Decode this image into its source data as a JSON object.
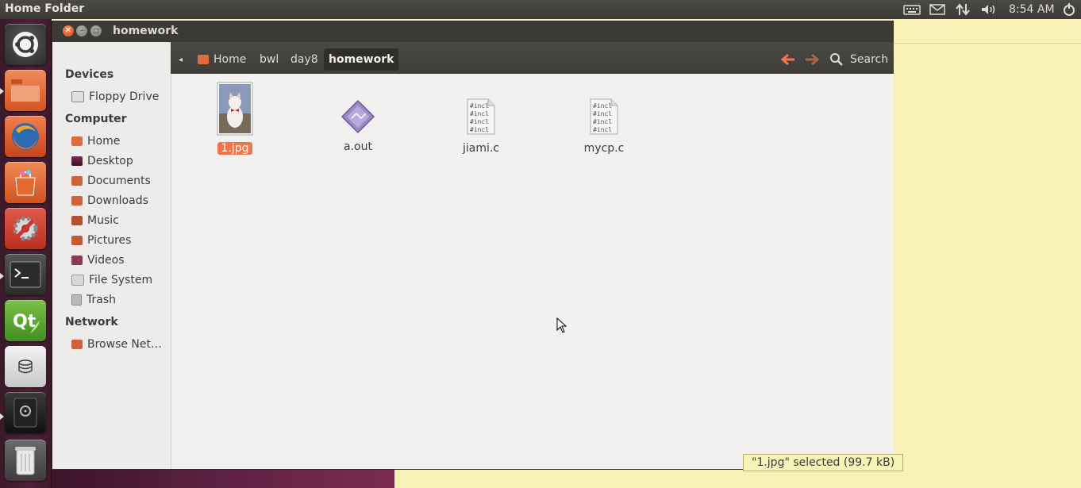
{
  "top_panel": {
    "title": "Home Folder",
    "clock": "8:54 AM",
    "tray_icons": [
      "keyboard-icon",
      "mail-icon",
      "network-icon",
      "volume-icon",
      "power-icon"
    ]
  },
  "launcher": {
    "items": [
      "ubuntu-dash-icon",
      "files-icon",
      "firefox-icon",
      "software-center-icon",
      "system-settings-icon",
      "terminal-icon",
      "qt-creator-icon",
      "disk-icon",
      "safe-icon",
      "trash-icon"
    ]
  },
  "window": {
    "title": "homework",
    "sidebar": {
      "devices_header": "Devices",
      "devices": [
        {
          "label": "Floppy Drive"
        }
      ],
      "computer_header": "Computer",
      "computer": [
        {
          "label": "Home"
        },
        {
          "label": "Desktop"
        },
        {
          "label": "Documents"
        },
        {
          "label": "Downloads"
        },
        {
          "label": "Music"
        },
        {
          "label": "Pictures"
        },
        {
          "label": "Videos"
        },
        {
          "label": "File System"
        },
        {
          "label": "Trash"
        }
      ],
      "network_header": "Network",
      "network": [
        {
          "label": "Browse Net…"
        }
      ]
    },
    "toolbar": {
      "breadcrumbs": [
        "Home",
        "bwl",
        "day8",
        "homework"
      ],
      "search_label": "Search"
    },
    "files": [
      {
        "name": "1.jpg",
        "selected": true
      },
      {
        "name": "a.out",
        "selected": false
      },
      {
        "name": "jiami.c",
        "selected": false
      },
      {
        "name": "mycp.c",
        "selected": false
      }
    ],
    "source_thumb_text": "#incl",
    "status": "\"1.jpg\" selected (99.7 kB)"
  },
  "colors": {
    "accent": "#ed764d",
    "panel": "#3c3b37",
    "desktop": "#f7f3b6"
  }
}
